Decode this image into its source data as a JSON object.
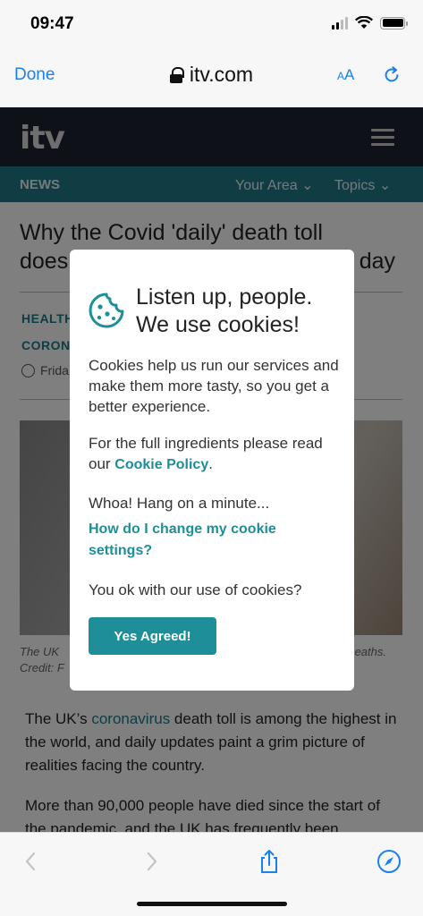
{
  "status": {
    "time": "09:47"
  },
  "browser": {
    "done_label": "Done",
    "url": "itv.com",
    "text_size_small": "A",
    "text_size_large": "A"
  },
  "site": {
    "logo": "itv",
    "nav": {
      "section": "NEWS",
      "your_area": "Your Area",
      "topics": "Topics"
    }
  },
  "article": {
    "headline_line1": "Why the Covid 'daily' death toll",
    "headline_line2_start": "does",
    "headline_line2_end": "day",
    "tag1": "HEALTH",
    "tag2": "CORON",
    "date": "Frida",
    "caption_start_line1": "The UK",
    "caption_end_line1": "eaths.",
    "caption_start_line2": "Credit: F",
    "p1_before": "The UK’s ",
    "p1_link": "coronavirus",
    "p1_after": " death toll is among the highest in the world, and daily updates paint a grim picture of realities facing the country.",
    "p2": "More than 90,000 people have died since the start of the pandemic, and the UK has frequently been"
  },
  "modal": {
    "title": "Listen up, people. We use cookies!",
    "intro": "Cookies help us run our services and make them more tasty, so you get a better experience.",
    "ingredients_text": "For the full ingredients please read our ",
    "policy_link": "Cookie Policy",
    "policy_period": ".",
    "whoa": "Whoa! Hang on a minute...",
    "change_link": "How do I change my cookie settings?",
    "question": "You ok with our use of cookies?",
    "agree_button": "Yes Agreed!"
  },
  "colors": {
    "accent": "#1e8f99",
    "ios_blue": "#1a82f0",
    "itv_dark": "#1f2230"
  }
}
